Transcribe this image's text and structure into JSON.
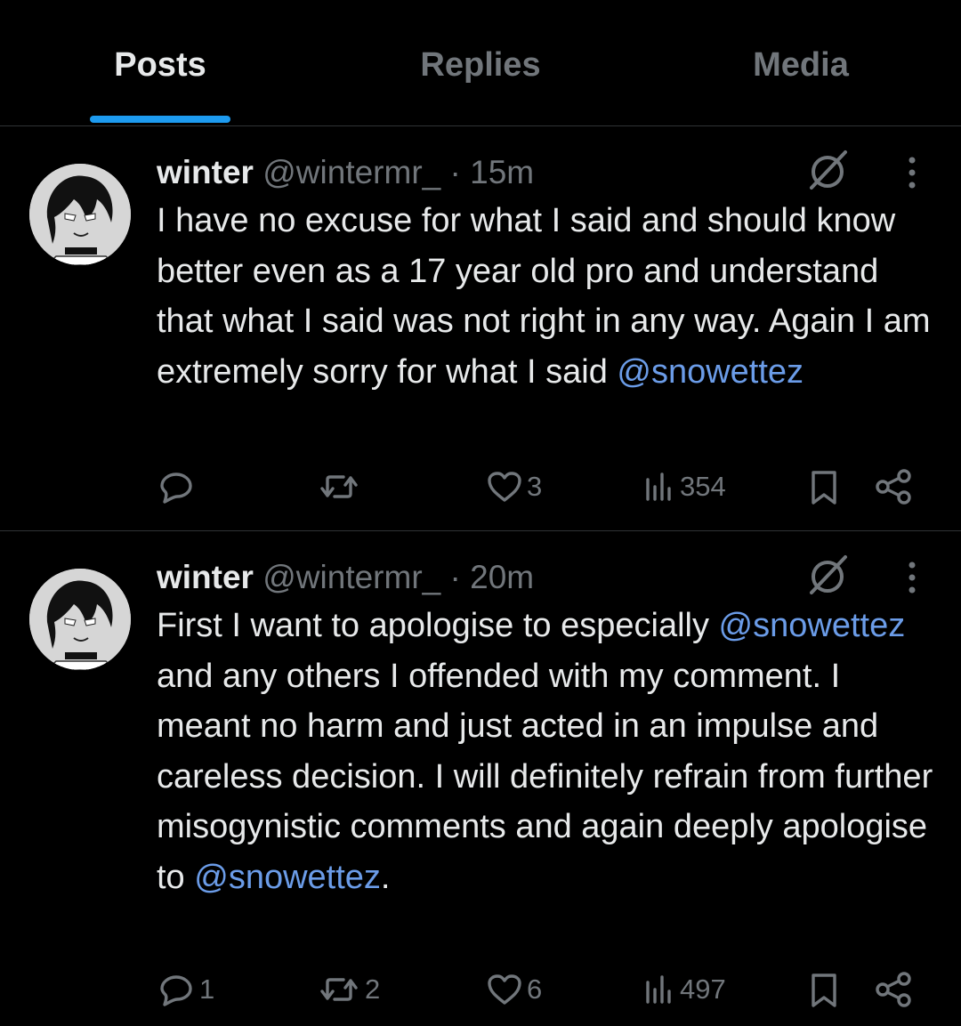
{
  "tabs": [
    {
      "label": "Posts",
      "active": true
    },
    {
      "label": "Replies",
      "active": false
    },
    {
      "label": "Media",
      "active": false
    }
  ],
  "tweets": [
    {
      "name": "winter",
      "handle": "@wintermr_",
      "separator": "·",
      "time": "15m",
      "text_parts": [
        "I have no excuse for what I said and should know better even as a 17 year old pro and understand that what I said was not right in any way. Again I am extremely sorry for what I said ",
        "@snowettez"
      ],
      "replies": "",
      "reposts": "",
      "likes": "3",
      "views": "354"
    },
    {
      "name": "winter",
      "handle": "@wintermr_",
      "separator": "·",
      "time": "20m",
      "text_parts": [
        "First I want to apologise to especially ",
        "@snowettez",
        " and any others I offended with my comment. I meant no harm and just acted in an impulse and careless decision. I will definitely refrain from further misogynistic comments and again deeply apologise to ",
        "@snowettez",
        "."
      ],
      "replies": "1",
      "reposts": "2",
      "likes": "6",
      "views": "497"
    }
  ],
  "colors": {
    "background": "#000000",
    "text": "#e7e9ea",
    "muted": "#71767b",
    "accent": "#1d9bf0",
    "mention": "#6b9ce8",
    "divider": "#2f3336"
  },
  "icons": {
    "reply": "reply-bubble-icon",
    "repost": "repost-arrows-icon",
    "like": "heart-outline-icon",
    "views": "views-bar-chart-icon",
    "bookmark": "bookmark-icon",
    "share": "share-nodes-icon",
    "grok": "grok-slash-circle-icon",
    "more": "vertical-dots-icon"
  }
}
